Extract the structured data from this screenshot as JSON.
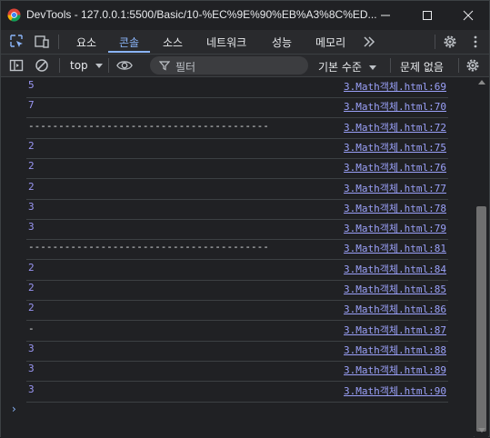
{
  "window": {
    "title": "DevTools - 127.0.0.1:5500/Basic/10-%EC%9E%90%EB%A3%8C%ED...",
    "icon": "chrome-icon"
  },
  "tabs": [
    {
      "label": "요소",
      "active": false
    },
    {
      "label": "콘솔",
      "active": true
    },
    {
      "label": "소스",
      "active": false
    },
    {
      "label": "네트워크",
      "active": false
    },
    {
      "label": "성능",
      "active": false
    },
    {
      "label": "메모리",
      "active": false
    }
  ],
  "toolbar": {
    "context": "top",
    "filter_placeholder": "필터",
    "levels": "기본 수준",
    "issues": "문제 없음"
  },
  "console": {
    "rows": [
      {
        "value": "5",
        "source": "3.Math객체.html:69",
        "kind": "number"
      },
      {
        "value": "7",
        "source": "3.Math객체.html:70",
        "kind": "number"
      },
      {
        "value": "----------------------------------------",
        "source": "3.Math객체.html:72",
        "kind": "string"
      },
      {
        "value": "2",
        "source": "3.Math객체.html:75",
        "kind": "number"
      },
      {
        "value": "2",
        "source": "3.Math객체.html:76",
        "kind": "number"
      },
      {
        "value": "2",
        "source": "3.Math객체.html:77",
        "kind": "number"
      },
      {
        "value": "3",
        "source": "3.Math객체.html:78",
        "kind": "number"
      },
      {
        "value": "3",
        "source": "3.Math객체.html:79",
        "kind": "number"
      },
      {
        "value": "----------------------------------------",
        "source": "3.Math객체.html:81",
        "kind": "string"
      },
      {
        "value": "2",
        "source": "3.Math객체.html:84",
        "kind": "number"
      },
      {
        "value": "2",
        "source": "3.Math객체.html:85",
        "kind": "number"
      },
      {
        "value": "2",
        "source": "3.Math객체.html:86",
        "kind": "number"
      },
      {
        "value": "-",
        "source": "3.Math객체.html:87",
        "kind": "string"
      },
      {
        "value": "3",
        "source": "3.Math객체.html:88",
        "kind": "number"
      },
      {
        "value": "3",
        "source": "3.Math객체.html:89",
        "kind": "number"
      },
      {
        "value": "3",
        "source": "3.Math객체.html:90",
        "kind": "number"
      }
    ],
    "prompt": "›"
  },
  "colors": {
    "accent": "#8ab4f8",
    "number": "#9a96f4",
    "background": "#202124"
  }
}
